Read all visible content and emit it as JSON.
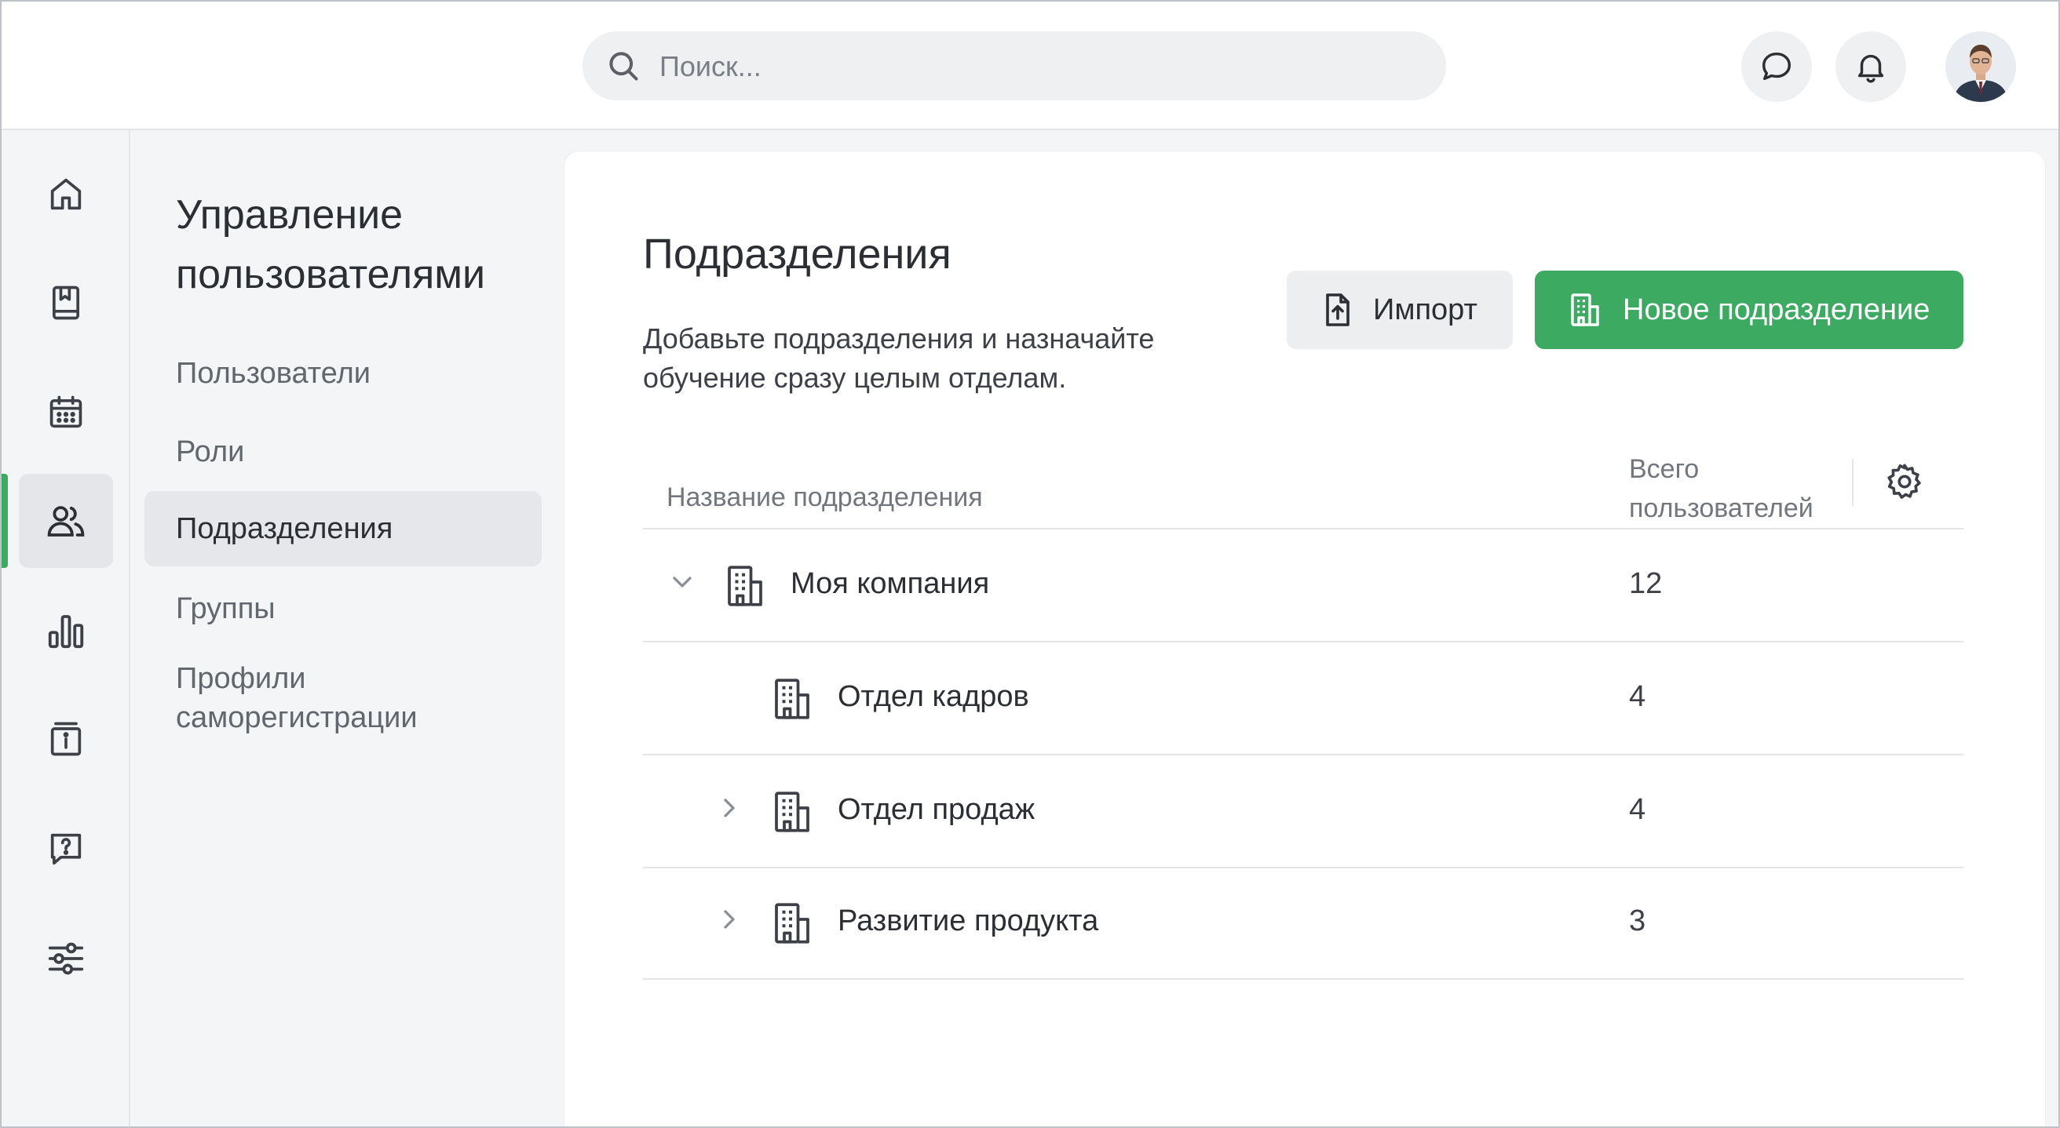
{
  "search": {
    "placeholder": "Поиск..."
  },
  "header": {
    "chat_icon": "chat-bubble-icon",
    "bell_icon": "bell-icon"
  },
  "rail": {
    "items": [
      {
        "icon": "home-icon"
      },
      {
        "icon": "book-icon"
      },
      {
        "icon": "calendar-icon"
      },
      {
        "icon": "users-icon",
        "active": true
      },
      {
        "icon": "bar-chart-icon"
      },
      {
        "icon": "info-board-icon"
      },
      {
        "icon": "help-bubble-icon"
      },
      {
        "icon": "sliders-icon"
      }
    ]
  },
  "subnav": {
    "title": "Управление пользователями",
    "items": [
      {
        "label": "Пользователи"
      },
      {
        "label": "Роли"
      },
      {
        "label": "Подразделения",
        "active": true
      },
      {
        "label": "Группы"
      },
      {
        "label": "Профили саморегистрации"
      }
    ]
  },
  "main": {
    "title": "Подразделения",
    "description": "Добавьте подразделения и назначайте обучение сразу целым отделам.",
    "import_label": "Импорт",
    "new_label": "Новое подразделение",
    "accent_color": "#3daa62",
    "table": {
      "col_name": "Название подразделения",
      "col_total": "Всего пользователей",
      "rows": [
        {
          "name": "Моя компания",
          "count": "12",
          "expander": "expanded"
        },
        {
          "name": "Отдел кадров",
          "count": "4",
          "expander": "none"
        },
        {
          "name": "Отдел продаж",
          "count": "4",
          "expander": "collapsed"
        },
        {
          "name": "Развитие продукта",
          "count": "3",
          "expander": "collapsed"
        }
      ]
    }
  }
}
